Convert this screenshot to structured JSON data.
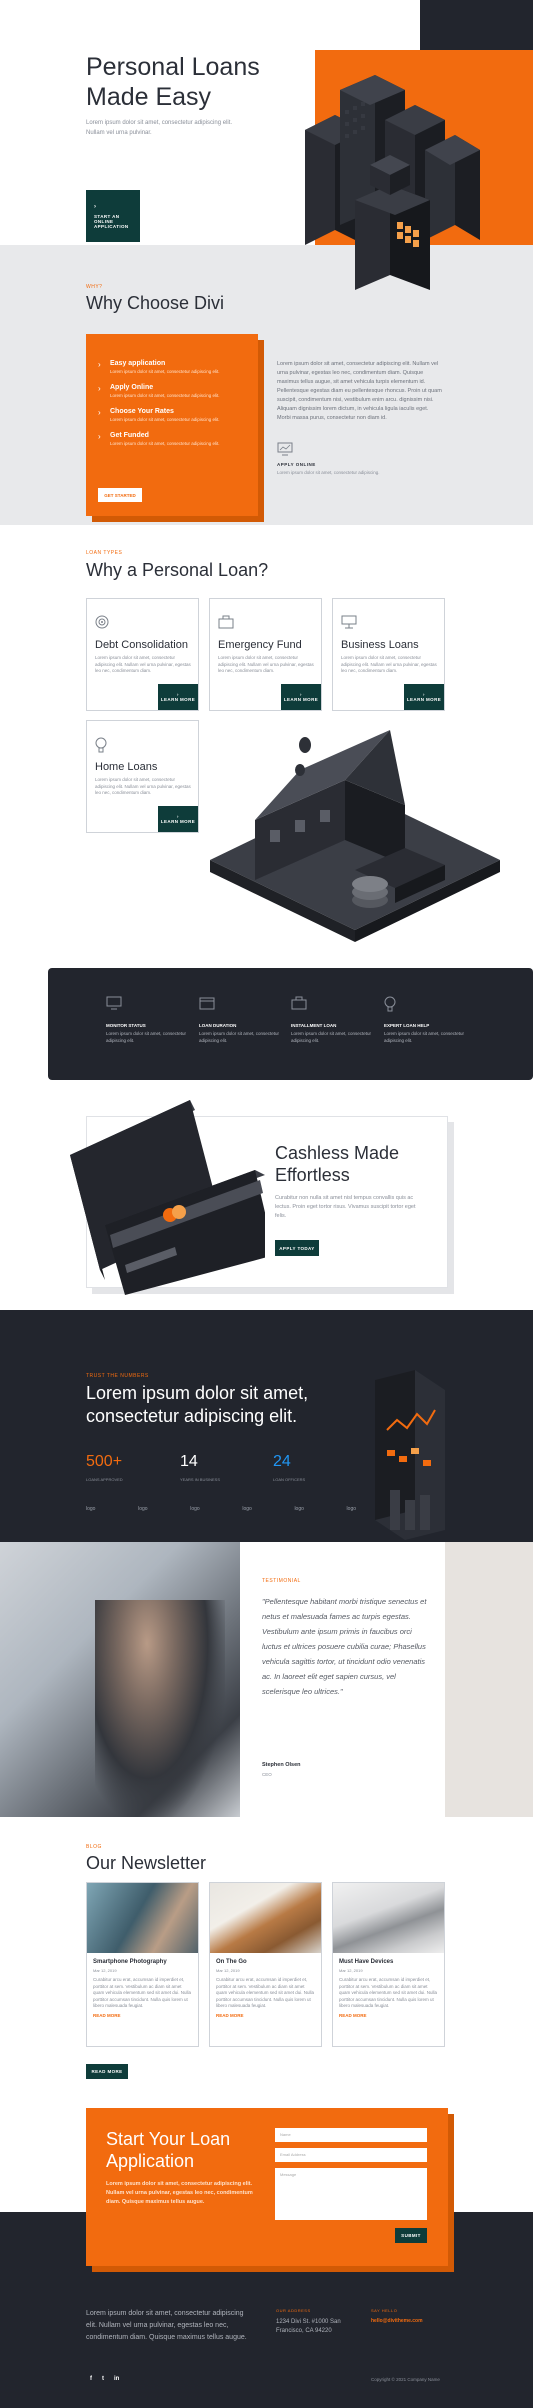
{
  "hero": {
    "title_line1": "Personal Loans",
    "title_line2": "Made Easy",
    "subtitle_line1": "Lorem ipsum dolor sit amet, consectetur adipiscing elit.",
    "subtitle_line2": "Nullam vel urna pulvinar.",
    "cta_line1": "START AN ONLINE",
    "cta_line2": "APPLICATION"
  },
  "why_divi": {
    "eyebrow": "WHY?",
    "title": "Why Choose Divi",
    "features": [
      {
        "title": "Easy application",
        "text": "Lorem ipsum dolor sit amet, consectetur adipiscing elit."
      },
      {
        "title": "Apply Online",
        "text": "Lorem ipsum dolor sit amet, consectetur adipiscing elit."
      },
      {
        "title": "Choose Your Rates",
        "text": "Lorem ipsum dolor sit amet, consectetur adipiscing elit."
      },
      {
        "title": "Get Funded",
        "text": "Lorem ipsum dolor sit amet, consectetur adipiscing elit."
      }
    ],
    "button": "GET STARTED",
    "body": "Lorem ipsum dolor sit amet, consectetur adipiscing elit. Nullam vel urna pulvinar, egestas leo nec, condimentum diam. Quisque maximus tellus augue, sit amet vehicula turpis elementum id. Pellentesque egestas diam eu pellentesque rhoncus. Proin ut quam suscipit, condimentum nisi, vestibulum enim arcu. dignissim nisi. Aliquam dignissim lorem dictum, in vehicula ligula iaculis eget. Morbi massa purus, consectetur non diam id.",
    "apply_title": "APPLY ONLINE",
    "apply_text": "Lorem ipsum dolor sit amet, consectetur adipiscing."
  },
  "why_loan": {
    "eyebrow": "LOAN TYPES",
    "title": "Why a Personal Loan?",
    "cards": [
      {
        "title": "Debt Consolidation",
        "text": "Lorem ipsum dolor sit amet, consectetur adipiscing elit. Nullam vel urna pulvinar, egestas leo nec, condimentum diam.",
        "button": "LEARN MORE"
      },
      {
        "title": "Emergency Fund",
        "text": "Lorem ipsum dolor sit amet, consectetur adipiscing elit. Nullam vel urna pulvinar, egestas leo nec, condimentum diam.",
        "button": "LEARN MORE"
      },
      {
        "title": "Business Loans",
        "text": "Lorem ipsum dolor sit amet, consectetur adipiscing elit. Nullam vel urna pulvinar, egestas leo nec, condimentum diam.",
        "button": "LEARN MORE"
      },
      {
        "title": "Home Loans",
        "text": "Lorem ipsum dolor sit amet, consectetur adipiscing elit. Nullam vel urna pulvinar, egestas leo nec, condimentum diam.",
        "button": "LEARN MORE"
      }
    ]
  },
  "features_band": [
    {
      "title": "MONITOR STATUS",
      "text": "Lorem ipsum dolor sit amet, consectetur adipiscing elit."
    },
    {
      "title": "LOAN DURATION",
      "text": "Lorem ipsum dolor sit amet, consectetur adipiscing elit."
    },
    {
      "title": "INSTALLMENT LOAN",
      "text": "Lorem ipsum dolor sit amet, consectetur adipiscing elit."
    },
    {
      "title": "EXPERT LOAN HELP",
      "text": "Lorem ipsum dolor sit amet, consectetur adipiscing elit."
    }
  ],
  "cashless": {
    "title_line1": "Cashless Made",
    "title_line2": "Effortless",
    "text": "Curabitur non nulla sit amet nisl tempus convallis quis ac lectus. Proin eget tortor risus. Vivamus suscipit tortor eget felis.",
    "button": "APPLY TODAY"
  },
  "numbers": {
    "eyebrow": "TRUST THE NUMBERS",
    "title_line1": "Lorem ipsum dolor sit amet,",
    "title_line2": "consectetur adipiscing elit.",
    "stats": [
      {
        "value": "500+",
        "label": "LOANS APPROVED"
      },
      {
        "value": "14",
        "label": "YEARS IN BUSINESS"
      },
      {
        "value": "24",
        "label": "LOAN OFFICERS"
      }
    ],
    "logos": [
      "logo",
      "logo",
      "logo",
      "logo",
      "logo",
      "logo"
    ]
  },
  "testimonial": {
    "eyebrow": "TESTIMONIAL",
    "quote": "\"Pellentesque habitant morbi tristique senectus et netus et malesuada fames ac turpis egestas. Vestibulum ante ipsum primis in faucibus orci luctus et ultrices posuere cubilia curae; Phasellus vehicula sagittis tortor, ut tincidunt odio venenatis ac. In laoreet elit eget sapien cursus, vel scelerisque leo ultrices.\"",
    "author": "Stephen Olsen",
    "role": "CEO"
  },
  "newsletter": {
    "eyebrow": "BLOG",
    "title": "Our Newsletter",
    "posts": [
      {
        "title": "Smartphone Photography",
        "date": "Mar 12, 2019",
        "text": "Curabitur arcu erat, accumsan id imperdiet et, porttitor at sem. Vestibulum ac diam sit amet quam vehicula elementum sed sit amet dui. Nulla porttitor accumsan tincidunt. Nulla quis lorem ut libero malesuada feugiat.",
        "link": "READ MORE"
      },
      {
        "title": "On The Go",
        "date": "Mar 12, 2019",
        "text": "Curabitur arcu erat, accumsan id imperdiet et, porttitor at sem. Vestibulum ac diam sit amet quam vehicula elementum sed sit amet dui. Nulla porttitor accumsan tincidunt. Nulla quis lorem ut libero malesuada feugiat.",
        "link": "READ MORE"
      },
      {
        "title": "Must Have Devices",
        "date": "Mar 12, 2019",
        "text": "Curabitur arcu erat, accumsan id imperdiet et, porttitor at sem. Vestibulum ac diam sit amet quam vehicula elementum sed sit amet dui. Nulla porttitor accumsan tincidunt. Nulla quis lorem ut libero malesuada feugiat.",
        "link": "READ MORE"
      }
    ],
    "button": "READ MORE"
  },
  "apply": {
    "title_line1": "Start Your Loan",
    "title_line2": "Application",
    "text": "Lorem ipsum dolor sit amet, consectetur adipiscing elit. Nullam vel urna pulvinar, egestas leo nec, condimentum diam. Quisque maximus tellus augue.",
    "name_placeholder": "Name",
    "email_placeholder": "Email Address",
    "message_placeholder": "Message",
    "submit": "SUBMIT"
  },
  "footer": {
    "text": "Lorem ipsum dolor sit amet, consectetur adipiscing elit. Nullam vel urna pulvinar, egestas leo nec, condimentum diam. Quisque maximus tellus augue.",
    "address_title": "OUR ADDRESS",
    "address_line1": "1234 Divi St. #1000 San",
    "address_line2": "Francisco, CA 94220",
    "mail_title": "SAY HELLO",
    "mail": "hello@divitheme.com",
    "social": [
      "f",
      "t",
      "in"
    ],
    "copyright": "Copyright © 2021 Company Name"
  },
  "colors": {
    "accent": "#f26b0f",
    "dark": "#22252d",
    "button": "#0e3c3a",
    "blue": "#2196f3"
  }
}
